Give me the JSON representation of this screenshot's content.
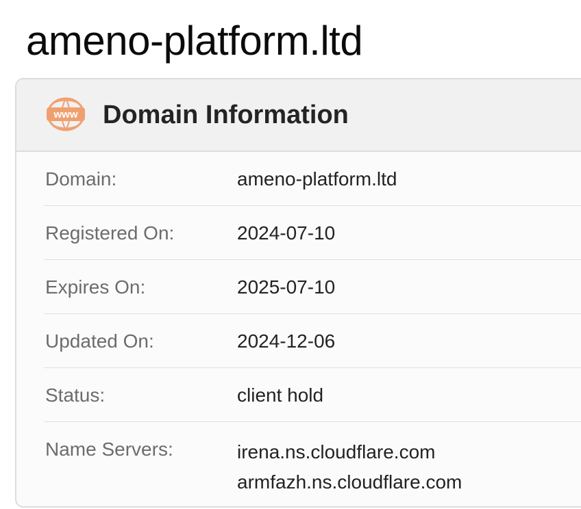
{
  "page": {
    "title": "ameno-platform.ltd"
  },
  "card": {
    "title": "Domain Information",
    "icon": "www-globe-icon",
    "icon_text": "www",
    "accent_color": "#f0a070"
  },
  "rows": [
    {
      "label": "Domain:",
      "value": "ameno-platform.ltd"
    },
    {
      "label": "Registered On:",
      "value": "2024-07-10"
    },
    {
      "label": "Expires On:",
      "value": "2025-07-10"
    },
    {
      "label": "Updated On:",
      "value": "2024-12-06"
    },
    {
      "label": "Status:",
      "value": "client hold"
    },
    {
      "label": "Name Servers:",
      "values": [
        "irena.ns.cloudflare.com",
        "armfazh.ns.cloudflare.com"
      ]
    }
  ]
}
